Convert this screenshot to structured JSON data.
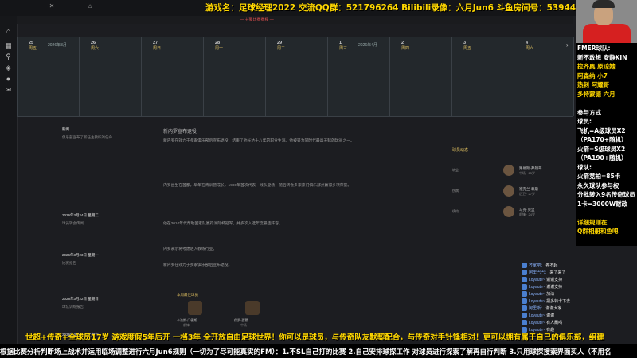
{
  "stream": {
    "title_overlay": "游戏名：足球经理2022  交流QQ群：521796264 Bilibili录像：六月Jun6 斗鱼房间号：539441 皮肤：FLAYUS"
  },
  "window": {
    "subtitle": "— 主要比赛赛程 —"
  },
  "calendar": {
    "days": [
      {
        "day": "25",
        "weekday": "周五",
        "month": "2026年3月"
      },
      {
        "day": "26",
        "weekday": "周六",
        "month": ""
      },
      {
        "day": "27",
        "weekday": "周日",
        "month": ""
      },
      {
        "day": "28",
        "weekday": "周一",
        "month": ""
      },
      {
        "day": "29",
        "weekday": "周二",
        "month": ""
      },
      {
        "day": "1",
        "weekday": "周三",
        "month": "2026年4月"
      },
      {
        "day": "2",
        "weekday": "周四",
        "month": ""
      },
      {
        "day": "3",
        "weekday": "周五",
        "month": ""
      },
      {
        "day": "4",
        "weekday": "周六",
        "month": ""
      }
    ]
  },
  "left_list": [
    {
      "text": "新闻",
      "header": true
    },
    {
      "text": "俱乐部宣布了新任主教练的任命",
      "header": false
    },
    {
      "text": "2026年3月24日 星期二",
      "header": true
    },
    {
      "text": "球员转会传闻",
      "header": false
    },
    {
      "text": "2026年3月23日 星期一",
      "header": true
    },
    {
      "text": "比赛报告",
      "header": false
    },
    {
      "text": "2026年3月22日 星期日",
      "header": true
    },
    {
      "text": "球队训练报告",
      "header": false
    },
    {
      "text": "2026年3月21日 星期六",
      "header": true
    }
  ],
  "article": {
    "title": "新内罗宣布退役",
    "paragraphs": [
      "新内罗在效力于多家俱乐部后宣布退役，结束了他长达十八年的职业生涯。他被誉为同时代最具天赋的球员之一。",
      "内罗出生在首都，早年在青训营成长，1998年首次代表一线队登场，随后转会多家豪门俱乐部并赢得多项荣誉。",
      "他在2010年代帮助国家队赢得洲际杯冠军，并多次入选年度最佳阵容。",
      "内罗表示将考虑进入教练行业。",
      "新内罗在效力于多家俱乐部后宣布退役。"
    ]
  },
  "right_card": {
    "header": "球员动态",
    "rows": [
      {
        "label": "转会",
        "name": "路易斯·弗朗哥",
        "sub": "中场 · 25岁"
      },
      {
        "label": "伤病",
        "name": "德克兰·赖斯",
        "sub": "后卫 · 27岁"
      },
      {
        "label": "续约",
        "name": "马克·贝里",
        "sub": "前锋 · 24岁"
      }
    ]
  },
  "bottom_card": {
    "header": "本周最佳球员",
    "players": [
      {
        "name": "卡洛斯·门德斯",
        "sub": "前锋"
      },
      {
        "name": "保罗·西蒙",
        "sub": "中场"
      }
    ]
  },
  "overlay_right": {
    "lines": [
      {
        "text": "FMER球队:",
        "color": "w"
      },
      {
        "text": "新不敢想 安静KIN",
        "color": "w"
      },
      {
        "text": "拉齐奥 原谅她",
        "color": "y"
      },
      {
        "text": "阿森纳 小7",
        "color": "y"
      },
      {
        "text": "热刺 阿耀哥",
        "color": "y"
      },
      {
        "text": "多特蒙德 六月",
        "color": "y"
      },
      {
        "text": "",
        "color": "w"
      },
      {
        "text": "参与方式",
        "color": "w"
      },
      {
        "text": "球员:",
        "color": "w"
      },
      {
        "text": "飞机=A级球员X2",
        "color": "w"
      },
      {
        "text": "（PA170+随机）",
        "color": "w"
      },
      {
        "text": "火箭=S级球员X2",
        "color": "w"
      },
      {
        "text": "（PA190+随机）",
        "color": "w"
      },
      {
        "text": "球队:",
        "color": "w"
      },
      {
        "text": "火箭竞拍=85卡",
        "color": "w"
      },
      {
        "text": "永久球队参与权",
        "color": "w"
      },
      {
        "text": "分批转入9名传奇球员",
        "color": "w"
      },
      {
        "text": "1卡=3000W财政",
        "color": "w"
      },
      {
        "text": "",
        "color": "w"
      },
      {
        "text": "详细规则在",
        "color": "y"
      },
      {
        "text": "Q群相册和鱼吧",
        "color": "y"
      }
    ]
  },
  "chat": {
    "messages": [
      {
        "user": "齐家吧：",
        "text": "卷不起"
      },
      {
        "user": "阿里巴巴：",
        "text": "来了来了"
      },
      {
        "user": "Loyaute~",
        "text": "谢谢支持"
      },
      {
        "user": "Loyaute~",
        "text": "谢谢支持"
      },
      {
        "user": "Loyaute~",
        "text": "加油"
      },
      {
        "user": "Loyaute~",
        "text": "把多转卡下去"
      },
      {
        "user": "阿里斯：",
        "text": "谢谢大家"
      },
      {
        "user": "Loyaute~",
        "text": "谢谢"
      },
      {
        "user": "Loyaute~",
        "text": "有人刷吗"
      },
      {
        "user": "Loyaute~",
        "text": "有趣"
      }
    ]
  },
  "tickers": {
    "line1": "世超+传奇+全球员17岁 游戏度假5年后开 一档3年 全开放自由足球世界！你可以是球员，与传奇队友默契配合，与传奇对手针锋相对！更可以拥有属于自己的俱乐部，组建",
    "line2": "根据比赛分析判断场上战术并运用临场调整进行六月Jun6规则（一切为了尽可能真实的FM）：1.不SL自己打的比赛 2.自己安排球探工作 对球员进行探索了解再自行判断 3.只用球探搜索界面买人（不用名"
  },
  "colors": {
    "accent_yellow": "#ffd700",
    "ticker_white": "#ffffff",
    "chat_user": "#8ab4ff",
    "background": "#1c1d21"
  }
}
